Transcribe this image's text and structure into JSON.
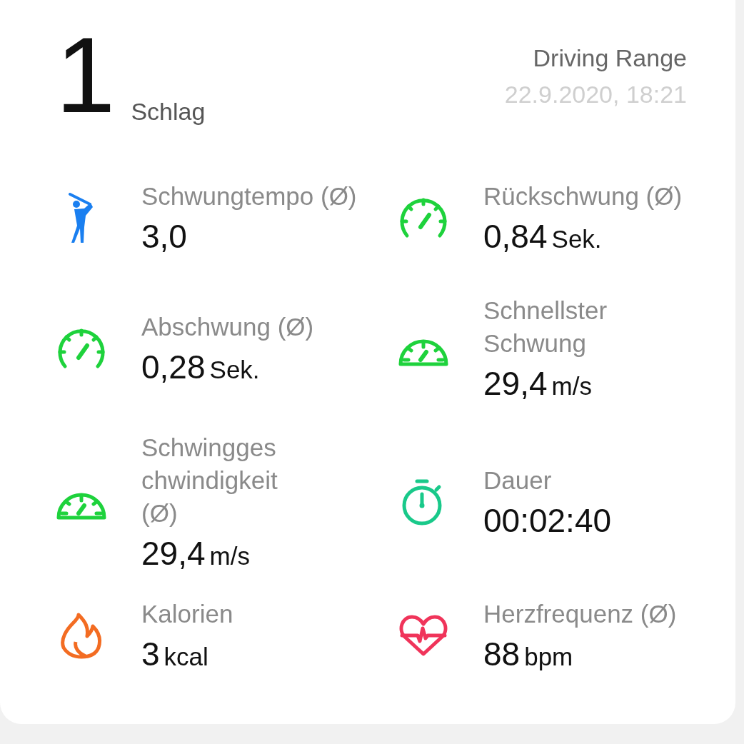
{
  "summary": {
    "count": "1",
    "count_label": "Schlag",
    "mode": "Driving Range",
    "datetime": "22.9.2020, 18:21"
  },
  "metric_rows": [
    [
      {
        "label": "Schwungtempo (Ø)",
        "value": "3,0"
      },
      {
        "label": "Rückschwung (Ø)",
        "value": "0,84",
        "unit": "Sek."
      }
    ],
    [
      {
        "label": "Abschwung (Ø)",
        "value": "0,28",
        "unit": "Sek."
      },
      {
        "label": "Schnellster\nSchwung",
        "value": "29,4",
        "unit": "m/s"
      }
    ],
    [
      {
        "label": "Schwingges\nchwindigkeit\n(Ø)",
        "value": "29,4",
        "unit": "m/s"
      },
      {
        "label": "Dauer",
        "value": "00:02:40"
      }
    ],
    [
      {
        "label": "Kalorien",
        "value": "3",
        "unit": "kcal"
      },
      {
        "label": "Herzfrequenz (Ø)",
        "value": "88",
        "unit": "bpm"
      }
    ]
  ]
}
